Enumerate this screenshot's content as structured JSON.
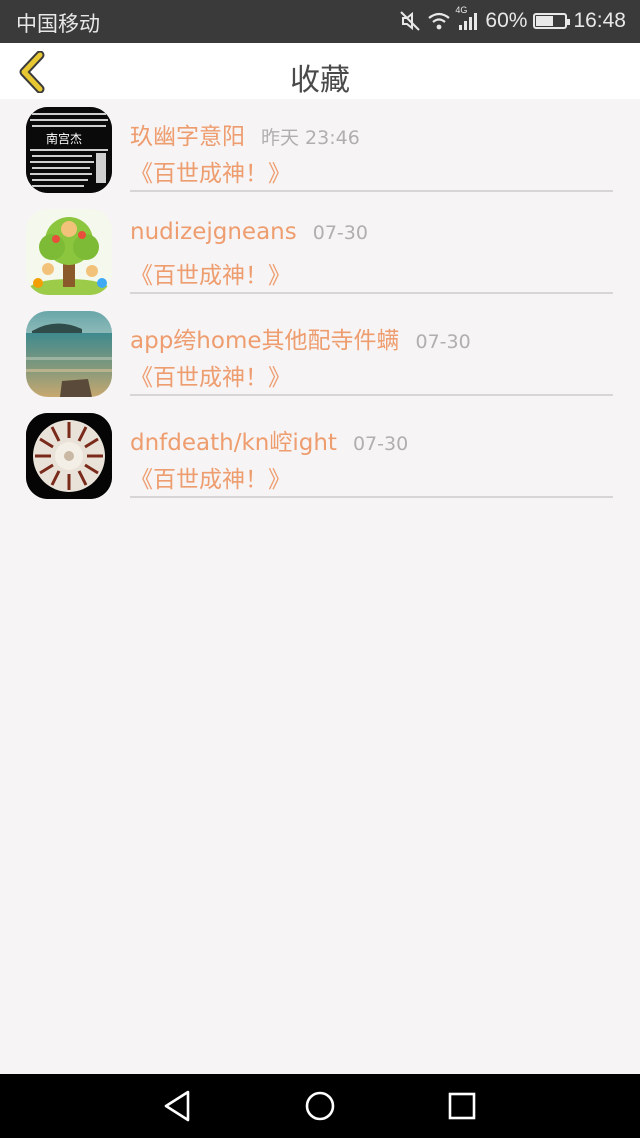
{
  "status_bar": {
    "carrier": "中国移动",
    "network": "4G",
    "battery_percent": "60%",
    "battery_level": 0.6,
    "time": "16:48",
    "icons": [
      "mute-icon",
      "wifi-icon",
      "signal-icon",
      "battery-icon"
    ]
  },
  "header": {
    "title": "收藏",
    "back_icon": "chevron-left-icon",
    "accent": "#e7c832"
  },
  "favorites": [
    {
      "name": "玖幽字意阳",
      "time": "昨天 23:46",
      "subtitle": "《百世成神！》"
    },
    {
      "name": "nudizejgneans",
      "time": "07-30",
      "subtitle": "《百世成神！》"
    },
    {
      "name": "app绔home其他配寺件螨",
      "time": "07-30",
      "subtitle": "《百世成神！》"
    },
    {
      "name": "dnfdeath/kn崆ight",
      "time": "07-30",
      "subtitle": "《百世成神！》"
    }
  ],
  "avatar_text": {
    "item0": "南宫杰"
  },
  "colors": {
    "name_text": "#ee9d6f",
    "time_text": "#b0aeae",
    "background": "#f6f4f5"
  },
  "system_nav": [
    "back-triangle-icon",
    "home-circle-icon",
    "recents-square-icon"
  ]
}
